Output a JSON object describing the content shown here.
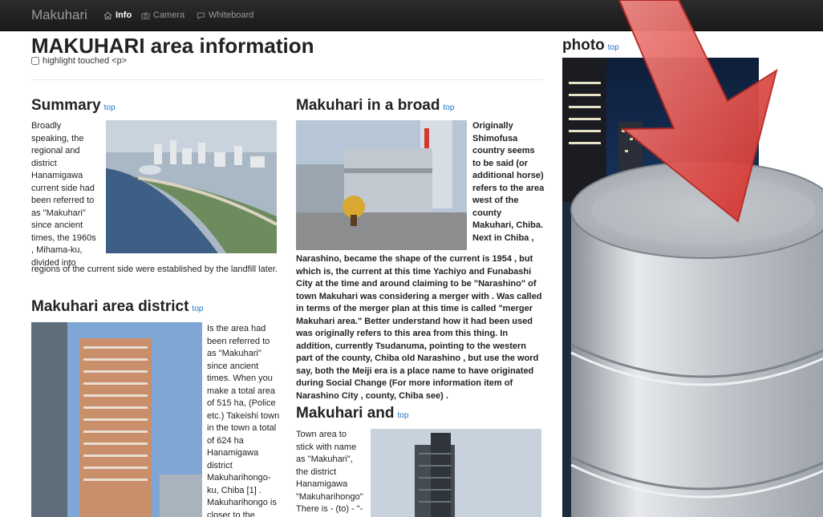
{
  "navbar": {
    "brand": "Makuhari",
    "items": [
      {
        "label": "Info",
        "icon": "home-icon",
        "active": true
      },
      {
        "label": "Camera",
        "icon": "camera-icon",
        "active": false
      },
      {
        "label": "Whiteboard",
        "icon": "whiteboard-icon",
        "active": false
      }
    ]
  },
  "page": {
    "title": "MAKUHARI area information",
    "highlight_label": "highlight touched <p>",
    "top_link": "top"
  },
  "sections": {
    "summary": {
      "heading": "Summary",
      "text_side": "Broadly speaking, the regional and district Hanamigawa current side had been referred to as \"Makuhari\" since ancient times, the 1960s , Mihama-ku, divided into",
      "text_below": "regions of the current side were established by the landfill later."
    },
    "area_district": {
      "heading": "Makuhari area district",
      "text_side": "Is the area had been referred to as \"Makuhari\" since ancient times. When you make a total area of 515 ha, (Police etc.) Takeishi town in the town a total of 624 ha Hanamigawa district Makuharihongo-ku, Chiba [1] . Makuharihongo is closer to the Narashino Of"
    },
    "broad": {
      "heading": "Makuhari in a broad",
      "text_side": "Originally Shimofusa country seems to be said (or additional horse) refers to the area west of the county Makuhari, Chiba. Next in Chiba ,",
      "text_below": "Narashino, became the shape of the current is 1954 , but which is, the current at this time Yachiyo and Funabashi City at the time and around claiming to be \"Narashino\" of town Makuhari was considering a merger with . Was called in terms of the merger plan at this time is called \"merger Makuhari area.\" Better understand how it had been used was originally refers to this area from this thing. In addition, currently Tsudanuma, pointing to the western part of the county, Chiba old Narashino , but use the word say, both the Meiji era is a place name to have originated during Social Change (For more information item of Narashino City , county, Chiba see) ."
    },
    "and": {
      "heading": "Makuhari and",
      "text_side": "Town area to stick with name as \"Makuhari\", the district Hanamigawa \"Makuharihongo\" There is - (to) - \"-Makuhari town\""
    },
    "photo": {
      "heading": "photo"
    }
  },
  "colors": {
    "navbar_bg": "#1b1b1b",
    "link": "#1a73c9",
    "arrow": "#e0413c",
    "database": "#c9ccd1"
  },
  "overlay": {
    "arrow_icon": "down-arrow-icon",
    "database_icon": "database-icon"
  }
}
